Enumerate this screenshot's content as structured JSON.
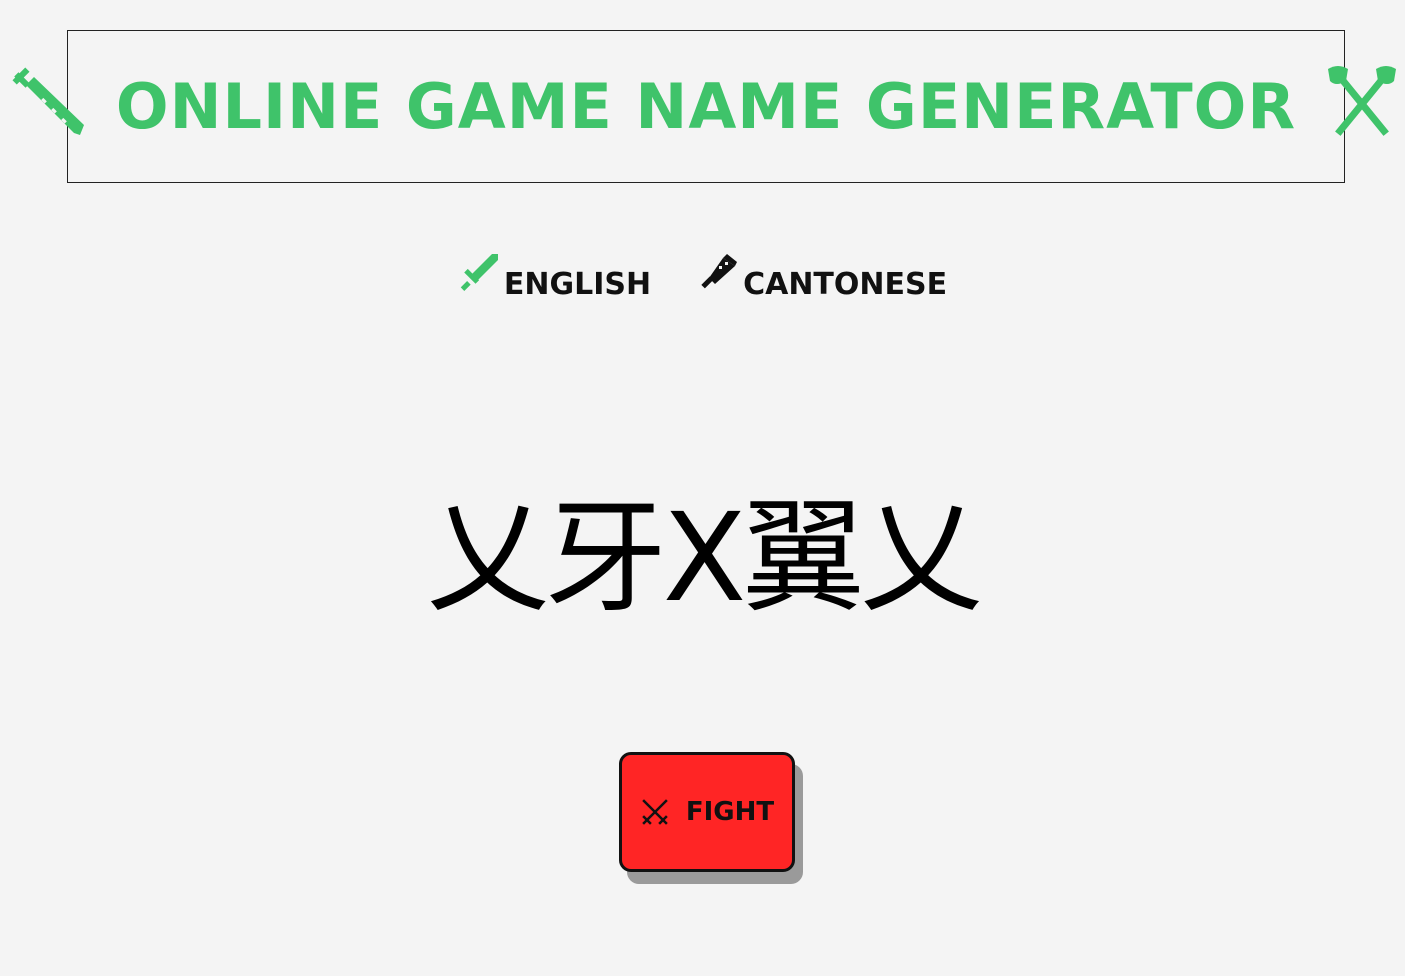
{
  "header": {
    "title": "ONLINE GAME NAME GENERATOR",
    "left_icon": "sword-icon",
    "right_icon": "crossed-axes-icon",
    "accent_color": "#3fc36a"
  },
  "languages": [
    {
      "label": "ENGLISH",
      "icon": "sword-icon",
      "icon_color": "#3fc36a"
    },
    {
      "label": "CANTONESE",
      "icon": "dagger-icon",
      "icon_color": "#111111"
    }
  ],
  "generated_name": "乂牙X翼乂",
  "fight_button": {
    "label": "FIGHT",
    "icon": "crossed-swords-icon",
    "color": "#ff2525"
  }
}
